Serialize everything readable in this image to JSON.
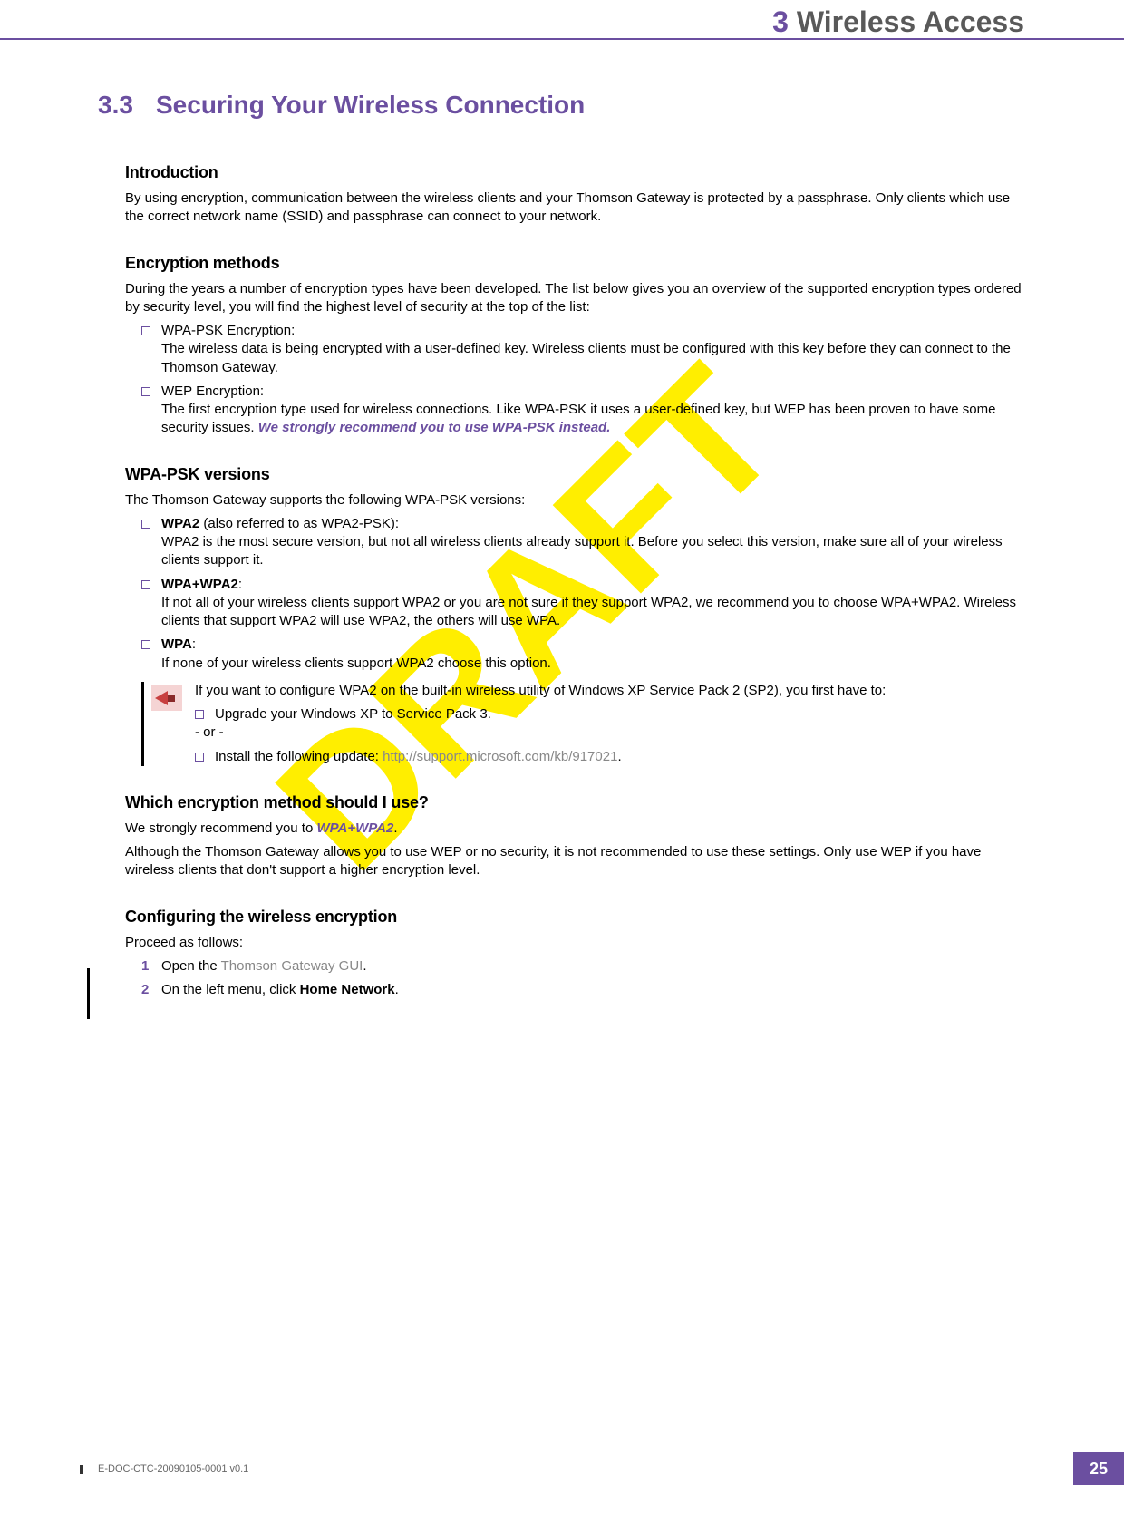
{
  "chapter": {
    "num": "3",
    "title": "Wireless Access"
  },
  "section": {
    "num": "3.3",
    "title": "Securing Your Wireless Connection"
  },
  "intro": {
    "heading": "Introduction",
    "body": "By using encryption, communication between the wireless clients and your Thomson Gateway is protected by a passphrase. Only clients which use the correct network name (SSID) and passphrase can connect to your network."
  },
  "methods": {
    "heading": "Encryption methods",
    "lead": "During the years a number of encryption types have been developed. The list below gives you an overview of the supported encryption types ordered by security level, you will find the highest level of security at the top of the list:",
    "item1_title": "WPA-PSK Encryption:",
    "item1_body": "The wireless data is being encrypted with a user-defined key. Wireless clients must be configured with this key before they can connect to the Thomson Gateway.",
    "item2_title": "WEP Encryption:",
    "item2_body": "The first encryption type used for wireless connections. Like WPA-PSK it uses a user-defined key, but WEP has been proven to have some security issues. ",
    "item2_em": "We strongly recommend you to use WPA-PSK instead."
  },
  "versions": {
    "heading": "WPA-PSK versions",
    "lead": "The Thomson Gateway supports the following WPA-PSK versions:",
    "v1_label": "WPA2",
    "v1_paren": " (also referred to as WPA2-PSK):",
    "v1_body": "WPA2 is the most secure version, but not all wireless clients already support it. Before you select this version, make sure all of your wireless clients support it.",
    "v2_label": "WPA+WPA2",
    "v2_colon": ":",
    "v2_body": "If not all of your wireless clients support WPA2 or you are not sure if they support WPA2, we recommend you to choose WPA+WPA2. Wireless clients that support WPA2 will use WPA2, the others will use WPA.",
    "v3_label": "WPA",
    "v3_colon": ":",
    "v3_body": "If none of your wireless clients support WPA2 choose this option.",
    "note_lead": "If you want to configure WPA2 on the built-in wireless utility of Windows XP Service Pack 2 (SP2), you first have to:",
    "note_a": "Upgrade your Windows XP to Service Pack 3.",
    "note_or": "- or -",
    "note_b_pre": "Install the following update: ",
    "note_b_link": "http://support.microsoft.com/kb/917021",
    "note_b_post": "."
  },
  "which": {
    "heading": "Which encryption method should I use?",
    "p1_pre": "We strongly recommend you to ",
    "p1_em": "WPA+WPA2",
    "p1_post": ".",
    "p2": "Although the Thomson Gateway allows you to use WEP or no security, it is not recommended to use these settings. Only use WEP if you have wireless clients that don't support a higher encryption level."
  },
  "config": {
    "heading": "Configuring the wireless encryption",
    "lead": "Proceed as follows:",
    "s1_num": "1",
    "s1_pre": "Open the ",
    "s1_link": "Thomson Gateway GUI",
    "s1_post": ".",
    "s2_num": "2",
    "s2_pre": "On the left menu, click ",
    "s2_bold": "Home Network",
    "s2_post": "."
  },
  "footer": {
    "docid": "E-DOC-CTC-20090105-0001 v0.1",
    "page": "25"
  },
  "watermark": "DRAFT"
}
